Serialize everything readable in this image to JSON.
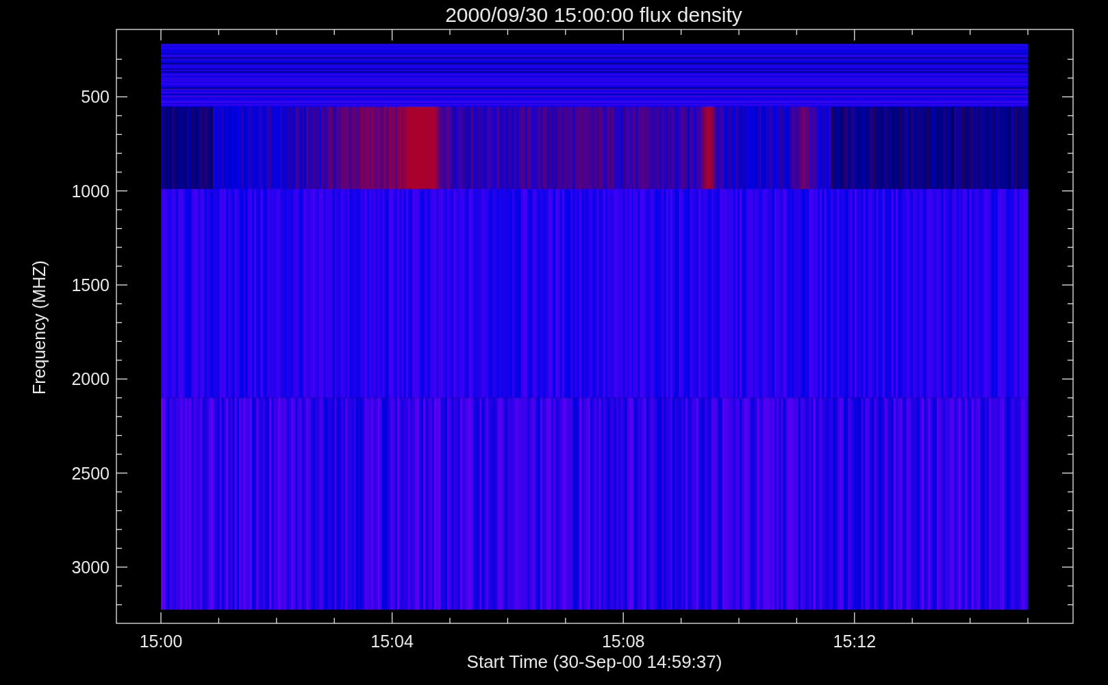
{
  "plot": {
    "title": "2000/09/30 15:00:00 flux density",
    "xlabel": "Start Time (30-Sep-00 14:59:37)",
    "ylabel": "Frequency (MHZ)",
    "x_tick_labels": [
      "15:00",
      "15:04",
      "15:08",
      "15:12"
    ],
    "y_tick_labels": [
      "500",
      "1000",
      "1500",
      "2000",
      "2500",
      "3000"
    ]
  }
}
